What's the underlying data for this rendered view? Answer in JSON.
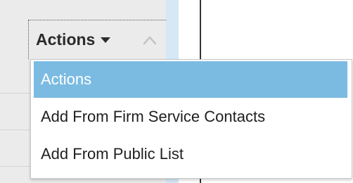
{
  "toolbar": {
    "actions_label": "Actions",
    "caret_icon": "caret-down-icon",
    "sort_icon": "chevron-up-icon"
  },
  "menu": {
    "items": [
      {
        "label": "Actions",
        "selected": true
      },
      {
        "label": "Add From Firm Service Contacts",
        "selected": false
      },
      {
        "label": "Add From Public List",
        "selected": false
      }
    ]
  },
  "colors": {
    "selected_bg": "#7bbbe2",
    "panel_bg": "#ebebeb",
    "scroll_strip": "#d6e8f6"
  }
}
